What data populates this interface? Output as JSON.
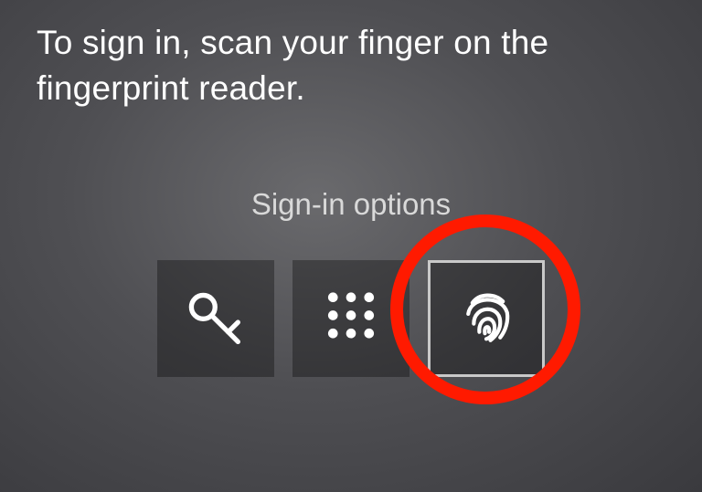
{
  "instruction": "To sign in, scan your finger on the fingerprint reader.",
  "options_label": "Sign-in options",
  "options": {
    "password": {
      "name": "password",
      "selected": false
    },
    "pin": {
      "name": "pin",
      "selected": false
    },
    "fingerprint": {
      "name": "fingerprint",
      "selected": true
    }
  },
  "annotation": {
    "highlight": "fingerprint",
    "highlight_color": "#ff1a00"
  }
}
